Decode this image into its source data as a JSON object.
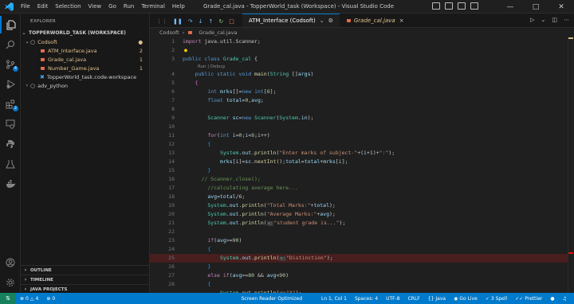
{
  "titlebar": {
    "menu": [
      "File",
      "Edit",
      "Selection",
      "View",
      "Go",
      "Run",
      "Terminal",
      "Help"
    ],
    "window_title": "Grade_cal.java - TopperWorld_task (Workspace) - Visual Studio Code"
  },
  "activity_bar": {
    "icons": [
      "explorer-icon",
      "search-icon",
      "source-control-icon",
      "run-debug-icon",
      "extensions-icon",
      "remote-explorer-icon",
      "python-icon",
      "testing-icon",
      "docker-icon"
    ],
    "badges": {
      "source_control": "4",
      "extensions": "2"
    }
  },
  "sidebar": {
    "title": "EXPLORER",
    "workspace": "TOPPERWORLD_TASK (WORKSPACE)",
    "folder": "Codsoft",
    "files": [
      {
        "name": "ATM_Interface.java",
        "count": "2",
        "color": "#e2c08d"
      },
      {
        "name": "Grade_cal.java",
        "count": "1",
        "color": "#e2c08d"
      },
      {
        "name": "Number_Game.java",
        "count": "1",
        "color": "#e2c08d"
      },
      {
        "name": "TopperWorld_task.code-workspace",
        "count": "",
        "color": "#cccccc"
      }
    ],
    "python_folder": "adv_python",
    "bottom_sections": [
      "OUTLINE",
      "TIMELINE",
      "JAVA PROJECTS"
    ]
  },
  "editor": {
    "debug_config": "ATM_Interface (Codsoft)",
    "active_tab": "Grade_cal.java",
    "breadcrumb": [
      "Codsoft",
      "Grade_cal.java"
    ],
    "codelens": "Run | Debug",
    "line_numbers": [
      "1",
      "2",
      "3",
      "4",
      "5",
      "6",
      "7",
      "8",
      "9",
      "10",
      "11",
      "12",
      "13",
      "14",
      "15",
      "16",
      "17",
      "18",
      "19",
      "20",
      "21",
      "22",
      "23",
      "24",
      "25",
      "26",
      "27",
      "28"
    ],
    "lines": [
      "import java.util.Scanner;",
      "",
      "public class Grade_cal {",
      "    public static void main(String []args)",
      "    {",
      "        int mrks[]=new int[6];",
      "        float total=0,avg;",
      "",
      "        Scanner sc=new Scanner(System.in);",
      "",
      "        for(int i=0;i<6;i++)",
      "        {",
      "            System.out.println(\"Enter marks of subject-\"+(i+1)+\":\");",
      "            mrks[i]=sc.nextInt();total=total+mrks[i];",
      "        }",
      "        // Scanner.close();",
      "        //calculating average here...",
      "        avg=total/6;",
      "        System.out.println(\"Total Marks:\"+total);",
      "        System.out.println(\"Average Marks:\"+avg);",
      "        System.out.println(\"student grade is...\");",
      "",
      "        if(avg>=90)",
      "        {",
      "            System.out.println(\"Distinction\");",
      "        }",
      "        else if(avg>=80 && avg<90)",
      "        {",
      "            System.out.println(\"A\");"
    ],
    "inlay_hint": "x:"
  },
  "statusbar": {
    "problems_errors": "0",
    "problems_warnings": "4",
    "ports": "0",
    "screen_reader": "Screen Reader Optimized",
    "position": "Ln 1, Col 1",
    "spaces": "Spaces: 4",
    "encoding": "UTF-8",
    "eol": "CRLF",
    "language": "Java",
    "go_live": "Go Live",
    "spell": "3 Spell",
    "prettier": "Prettier"
  }
}
